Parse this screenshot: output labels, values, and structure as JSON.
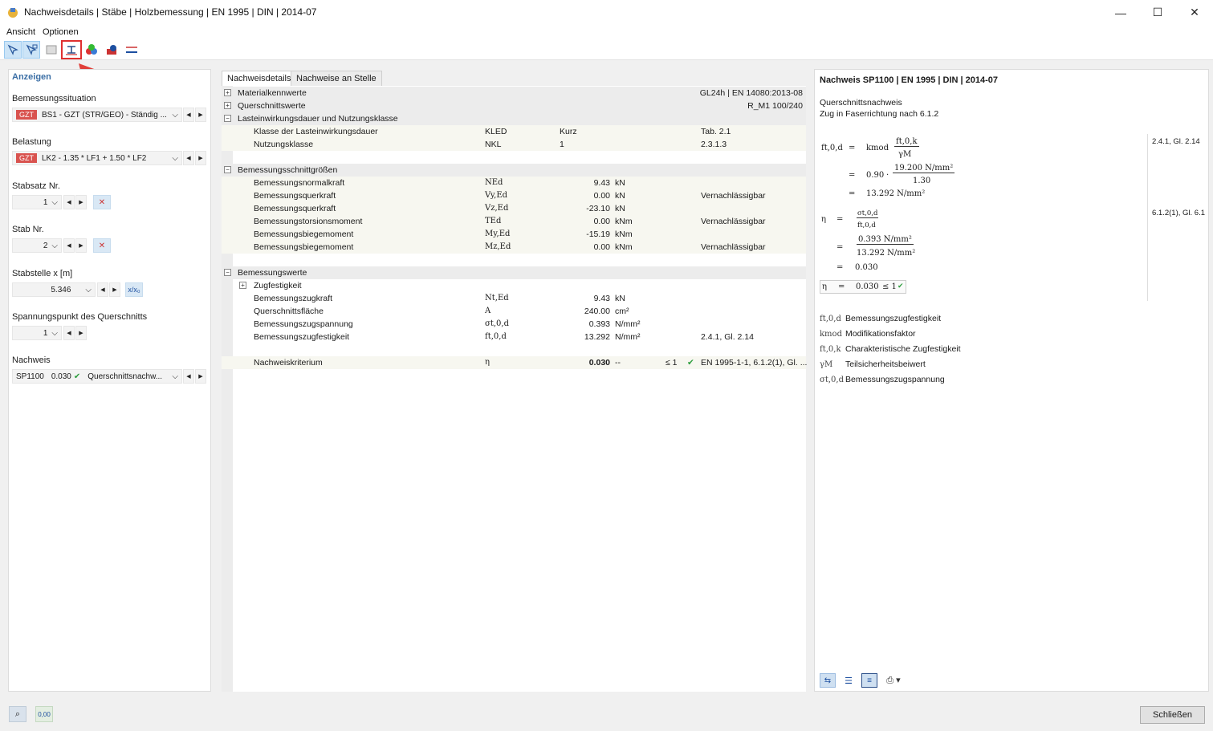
{
  "window": {
    "title": "Nachweisdetails | Stäbe | Holzbemessung | EN 1995 | DIN | 2014-07"
  },
  "menu": [
    "Ansicht",
    "Optionen"
  ],
  "left": {
    "section_title": "Anzeigen",
    "bemessungssituation": {
      "label": "Bemessungssituation",
      "tag": "GZT",
      "value": "BS1 - GZT (STR/GEO) - Ständig ..."
    },
    "belastung": {
      "label": "Belastung",
      "tag": "GZT",
      "value": "LK2 - 1.35 * LF1 + 1.50 * LF2"
    },
    "stabsatz": {
      "label": "Stabsatz Nr.",
      "value": "1"
    },
    "stab": {
      "label": "Stab Nr.",
      "value": "2"
    },
    "stabstelle": {
      "label": "Stabstelle x [m]",
      "value": "5.346",
      "xbtn": "x/x₀"
    },
    "spannungspunkt": {
      "label": "Spannungspunkt des Querschnitts",
      "value": "1"
    },
    "nachweis": {
      "label": "Nachweis",
      "id": "SP1100",
      "ratio": "0.030",
      "type": "Querschnittsnachw..."
    }
  },
  "tabs": [
    "Nachweisdetails",
    "Nachweise an Stelle"
  ],
  "grid": {
    "materialkennwerte": {
      "label": "Materialkennwerte",
      "value": "GL24h | EN 14080:2013-08"
    },
    "querschnittswerte": {
      "label": "Querschnittswerte",
      "value": "R_M1 100/240"
    },
    "lasteinwirkung": {
      "label": "Lasteinwirkungsdauer und Nutzungsklasse",
      "rows": [
        {
          "name": "Klasse der Lasteinwirkungsdauer",
          "sym": "KLED",
          "val": "Kurz",
          "ref": "Tab. 2.1"
        },
        {
          "name": "Nutzungsklasse",
          "sym": "NKL",
          "val": "1",
          "ref": "2.3.1.3"
        }
      ]
    },
    "schnittgroessen": {
      "label": "Bemessungsschnittgrößen",
      "rows": [
        {
          "name": "Bemessungsnormalkraft",
          "sym": "NEd",
          "val": "9.43",
          "unit": "kN",
          "note": ""
        },
        {
          "name": "Bemessungsquerkraft",
          "sym": "Vy,Ed",
          "val": "0.00",
          "unit": "kN",
          "note": "Vernachlässigbar"
        },
        {
          "name": "Bemessungsquerkraft",
          "sym": "Vz,Ed",
          "val": "-23.10",
          "unit": "kN",
          "note": ""
        },
        {
          "name": "Bemessungstorsionsmoment",
          "sym": "TEd",
          "val": "0.00",
          "unit": "kNm",
          "note": "Vernachlässigbar"
        },
        {
          "name": "Bemessungsbiegemoment",
          "sym": "My,Ed",
          "val": "-15.19",
          "unit": "kNm",
          "note": ""
        },
        {
          "name": "Bemessungsbiegemoment",
          "sym": "Mz,Ed",
          "val": "0.00",
          "unit": "kNm",
          "note": "Vernachlässigbar"
        }
      ]
    },
    "bemessungswerte": {
      "label": "Bemessungswerte",
      "zug": "Zugfestigkeit",
      "rows": [
        {
          "name": "Bemessungszugkraft",
          "sym": "Nt,Ed",
          "val": "9.43",
          "unit": "kN",
          "note": ""
        },
        {
          "name": "Querschnittsfläche",
          "sym": "A",
          "val": "240.00",
          "unit": "cm²",
          "note": ""
        },
        {
          "name": "Bemessungszugspannung",
          "sym": "σt,0,d",
          "val": "0.393",
          "unit": "N/mm²",
          "note": ""
        },
        {
          "name": "Bemessungszugfestigkeit",
          "sym": "ft,0,d",
          "val": "13.292",
          "unit": "N/mm²",
          "note": "2.4.1, Gl. 2.14"
        }
      ]
    },
    "kriterium": {
      "name": "Nachweiskriterium",
      "sym": "η",
      "val": "0.030",
      "unit": "--",
      "cond": "≤ 1",
      "ref": "EN 1995-1-1, 6.1.2(1), Gl. ..."
    }
  },
  "right": {
    "title": "Nachweis SP1100 | EN 1995 | DIN | 2014-07",
    "sub1": "Querschnittsnachweis",
    "sub2": "Zug in Faserrichtung nach 6.1.2",
    "ref1": "2.4.1, Gl. 2.14",
    "ref2": "6.1.2(1), Gl. 6.1",
    "eq": {
      "f_lhs": "ft,0,d",
      "kmod": "kmod",
      "ftok": "ft,0,k",
      "gm": "γM",
      "kval": "0.90",
      "fnum": "19.200 N/mm²",
      "fden": "1.30",
      "fres": "13.292 N/mm²",
      "eta": "η",
      "snum": "σt,0,d",
      "sden": "ft,0,d",
      "nnum": "0.393 N/mm²",
      "nden": "13.292 N/mm²",
      "eres": "0.030",
      "final": "0.030",
      "final_cond": "≤ 1"
    },
    "legend": [
      {
        "sym": "ft,0,d",
        "desc": "Bemessungszugfestigkeit"
      },
      {
        "sym": "kmod",
        "desc": "Modifikationsfaktor"
      },
      {
        "sym": "ft,0,k",
        "desc": "Charakteristische Zugfestigkeit"
      },
      {
        "sym": "γM",
        "desc": "Teilsicherheitsbeiwert"
      },
      {
        "sym": "σt,0,d",
        "desc": "Bemessungszugspannung"
      }
    ]
  },
  "footer": {
    "close": "Schließen",
    "status_icon": "0,00"
  }
}
